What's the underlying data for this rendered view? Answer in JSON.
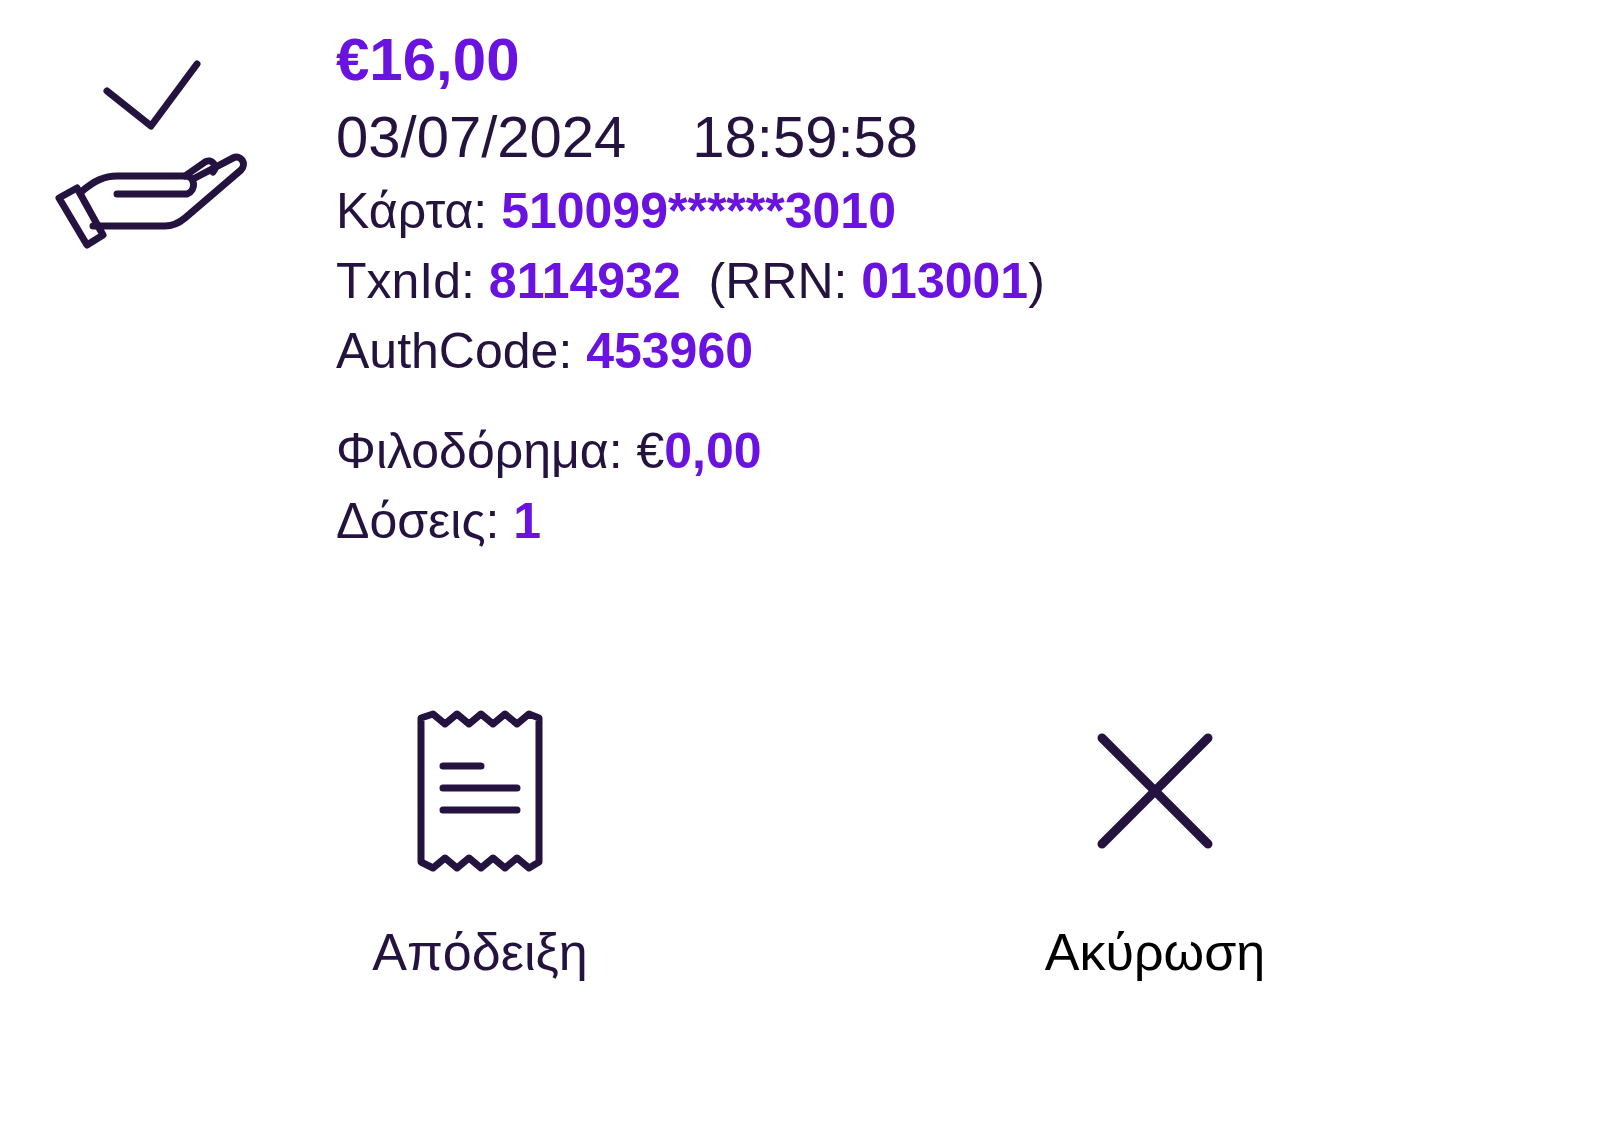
{
  "amount": "€16,00",
  "date": "03/07/2024",
  "time": "18:59:58",
  "details": [
    {
      "parts": [
        {
          "kind": "label",
          "text": "Κάρτα: "
        },
        {
          "kind": "value",
          "text": "510099******3010"
        }
      ]
    },
    {
      "parts": [
        {
          "kind": "label",
          "text": "TxnId: "
        },
        {
          "kind": "value",
          "text": "8114932"
        },
        {
          "kind": "label",
          "text": "  (RRN: "
        },
        {
          "kind": "value",
          "text": "013001"
        },
        {
          "kind": "label",
          "text": ")"
        }
      ]
    },
    {
      "parts": [
        {
          "kind": "label",
          "text": "AuthCode: "
        },
        {
          "kind": "value",
          "text": "453960"
        }
      ]
    }
  ],
  "extras": [
    {
      "parts": [
        {
          "kind": "label",
          "text": "Φιλοδόρημα: €"
        },
        {
          "kind": "value",
          "text": "0,00"
        }
      ]
    },
    {
      "parts": [
        {
          "kind": "label",
          "text": "Δόσεις: "
        },
        {
          "kind": "value",
          "text": "1"
        }
      ]
    }
  ],
  "actions": [
    {
      "kind": "receipt",
      "label": "Απόδειξη"
    },
    {
      "kind": "cancel",
      "label": "Ακύρωση"
    }
  ]
}
